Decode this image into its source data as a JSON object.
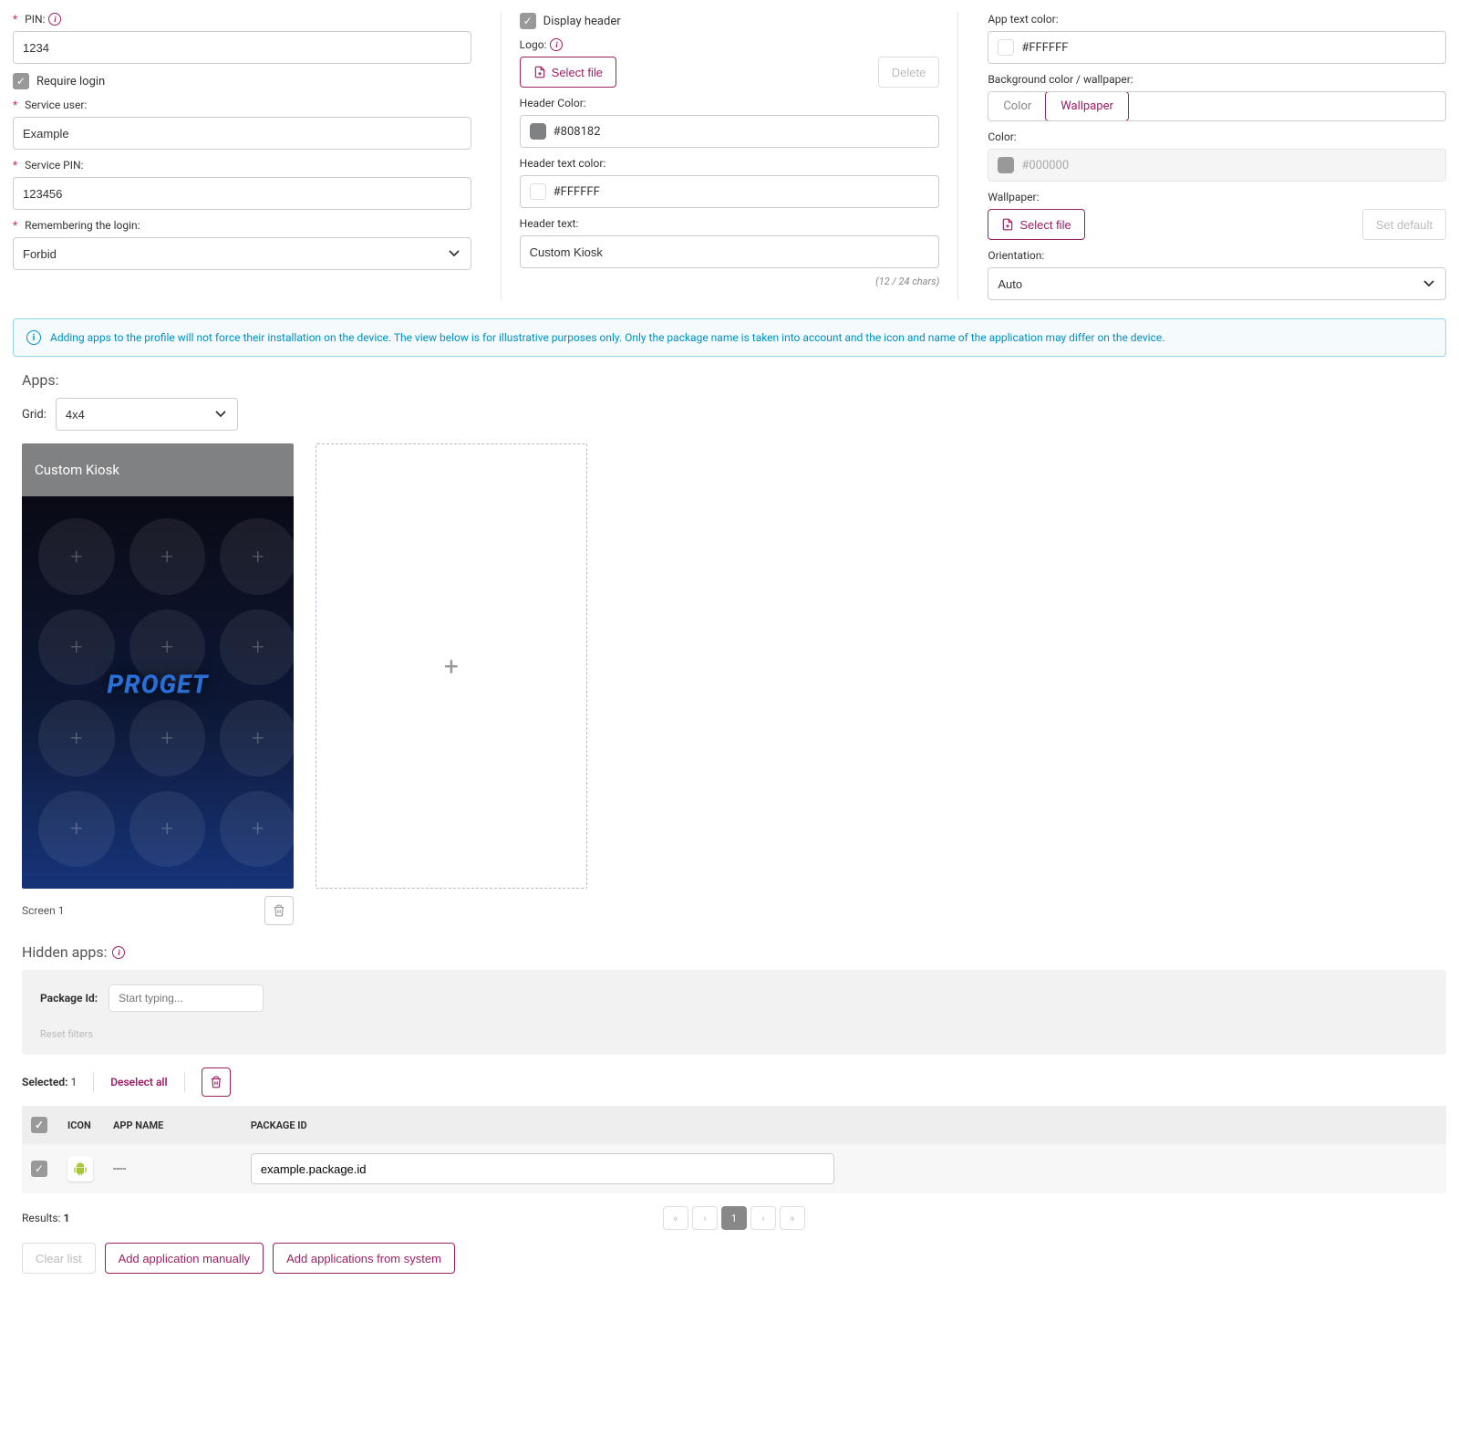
{
  "left": {
    "pin_label": "PIN:",
    "pin_value": "1234",
    "require_login": "Require login",
    "service_user_label": "Service user:",
    "service_user_value": "Example",
    "service_pin_label": "Service PIN:",
    "service_pin_value": "123456",
    "remembering_label": "Remembering the login:",
    "remembering_value": "Forbid"
  },
  "mid": {
    "display_header": "Display header",
    "logo_label": "Logo:",
    "select_file": "Select file",
    "delete": "Delete",
    "header_color_label": "Header Color:",
    "header_color_value": "#808182",
    "header_text_color_label": "Header text color:",
    "header_text_color_value": "#FFFFFF",
    "header_text_label": "Header text:",
    "header_text_value": "Custom Kiosk",
    "char_count": "(12 / 24 chars)"
  },
  "right": {
    "app_text_color_label": "App text color:",
    "app_text_color_value": "#FFFFFF",
    "bg_label": "Background color / wallpaper:",
    "seg_color": "Color",
    "seg_wallpaper": "Wallpaper",
    "color_label": "Color:",
    "color_value": "#000000",
    "wallpaper_label": "Wallpaper:",
    "select_file": "Select file",
    "set_default": "Set default",
    "orientation_label": "Orientation:",
    "orientation_value": "Auto"
  },
  "banner": "Adding apps to the profile will not force their installation on the device. The view below is for illustrative purposes only. Only the package name is taken into account and the icon and name of the application may differ on the device.",
  "apps": {
    "title": "Apps:",
    "grid_label": "Grid:",
    "grid_value": "4x4",
    "phone_header": "Custom Kiosk",
    "wallpaper_brand": "PROGET",
    "screen_label": "Screen 1"
  },
  "hidden": {
    "title": "Hidden apps:",
    "package_id_label": "Package Id:",
    "package_id_placeholder": "Start typing...",
    "reset_filters": "Reset filters",
    "selected_label": "Selected:",
    "selected_count": "1",
    "deselect_all": "Deselect all",
    "columns": {
      "icon": "ICON",
      "app_name": "APP NAME",
      "package_id": "PACKAGE ID"
    },
    "row": {
      "app_name": "----",
      "package_id": "example.package.id"
    },
    "results_label": "Results:",
    "results_count": "1",
    "page": "1",
    "clear_list": "Clear list",
    "add_manually": "Add application manually",
    "add_from_system": "Add applications from system"
  }
}
